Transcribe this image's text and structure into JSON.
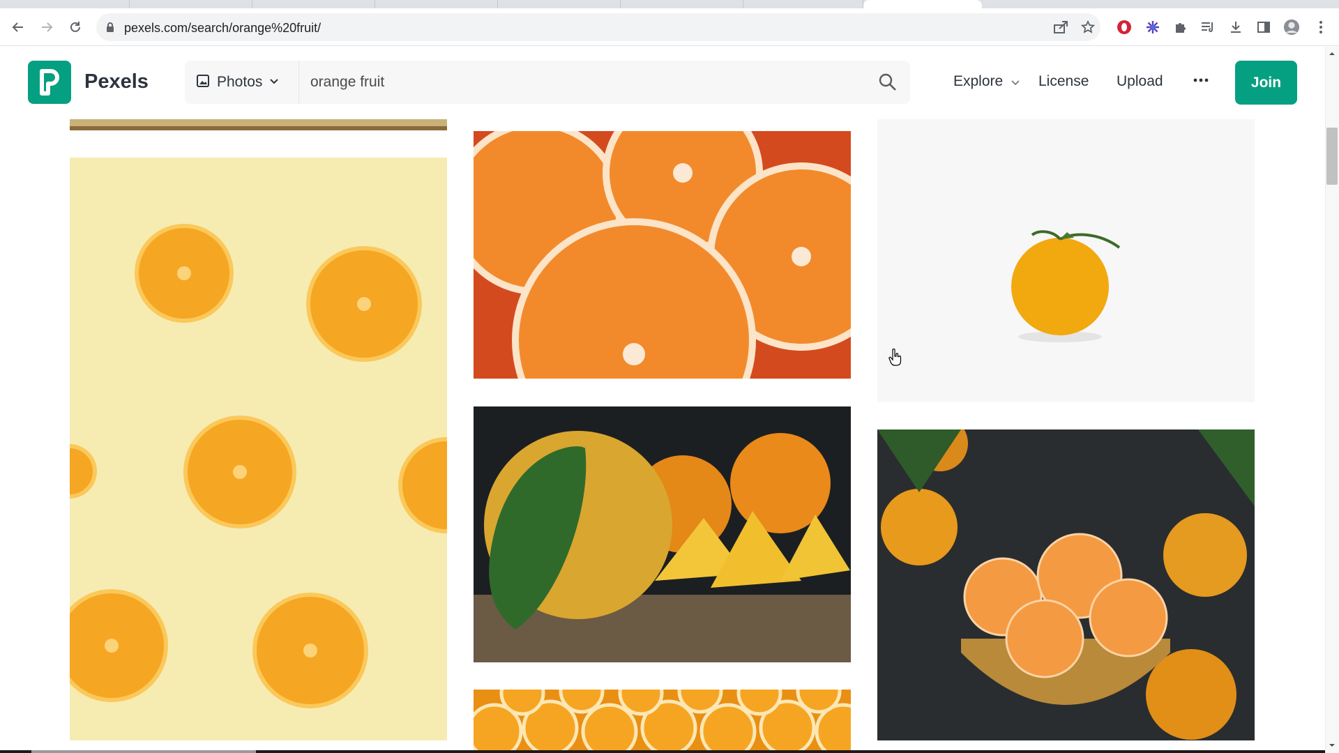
{
  "browser": {
    "url": "pexels.com/search/orange%20fruit/",
    "icons": [
      "back-icon",
      "forward-icon",
      "reload-icon",
      "lock-icon",
      "share-icon",
      "star-icon",
      "opera-extension-icon",
      "snowflake-extension-icon",
      "puzzle-extensions-icon",
      "reading-list-icon",
      "download-icon",
      "side-panel-icon",
      "profile-avatar",
      "kebab-menu-icon"
    ]
  },
  "header": {
    "brand": "Pexels",
    "media_type": "Photos",
    "search_value": "orange fruit",
    "nav": {
      "explore": "Explore",
      "license": "License",
      "upload": "Upload"
    },
    "join": "Join"
  },
  "photos": [
    {
      "name": "cut-orange-slices-on-yellow-background"
    },
    {
      "name": "blood-orange-halves-closeup"
    },
    {
      "name": "single-orange-on-white"
    },
    {
      "name": "oranges-with-leaf-and-wedges-on-board"
    },
    {
      "name": "peeled-tangerines-in-brass-bowl"
    },
    {
      "name": "rows-of-halved-oranges"
    }
  ],
  "colors": {
    "brand": "#05a081",
    "text": "#2c343e"
  }
}
